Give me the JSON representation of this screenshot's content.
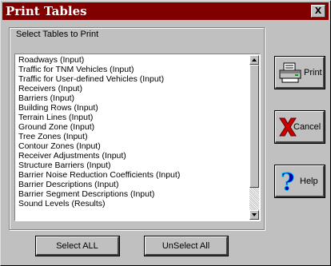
{
  "window": {
    "title": "Print Tables",
    "close_glyph": "X"
  },
  "group": {
    "label": "Select Tables to Print"
  },
  "tables": [
    "Roadways (Input)",
    "Traffic for TNM Vehicles (Input)",
    "Traffic for User-defined Vehicles (Input)",
    "Receivers (Input)",
    "Barriers (Input)",
    "Building Rows (Input)",
    "Terrain Lines (Input)",
    "Ground Zone (Input)",
    "Tree Zones (Input)",
    "Contour Zones (Input)",
    "Receiver Adjustments (Input)",
    "Structure Barriers (Input)",
    "Barrier Noise Reduction Coefficients (Input)",
    "Barrier Descriptions (Input)",
    "Barrier Segment Descriptions (Input)",
    "Sound Levels (Results)"
  ],
  "buttons": {
    "print": {
      "label": "Print",
      "icon": "printer-icon"
    },
    "cancel": {
      "label": "Cancel",
      "icon": "red-x-icon"
    },
    "help": {
      "label": "Help",
      "icon": "question-mark-icon"
    },
    "select_all": "Select ALL",
    "unselect_all": "UnSelect All"
  },
  "colors": {
    "titlebar": "#800000",
    "face": "#c0c0c0",
    "cancel_x": "#cc0000",
    "help_q": "#0000aa"
  }
}
